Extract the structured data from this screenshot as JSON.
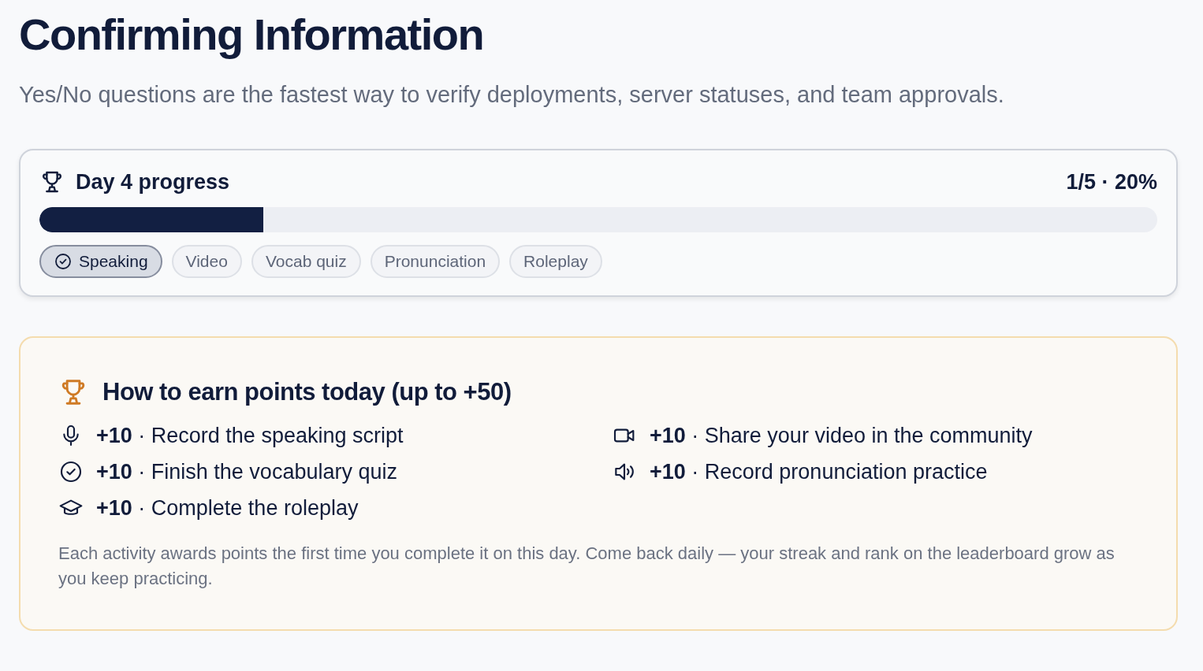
{
  "title": "Confirming Information",
  "subtitle": "Yes/No questions are the fastest way to verify deployments, server statuses, and team approvals.",
  "progress": {
    "title": "Day 4 progress",
    "summary": "1/5 · 20%",
    "level": 0.2,
    "chips": [
      {
        "label": "Speaking",
        "selected": true
      },
      {
        "label": "Video",
        "selected": false
      },
      {
        "label": "Vocab quiz",
        "selected": false
      },
      {
        "label": "Pronunciation",
        "selected": false
      },
      {
        "label": "Roleplay",
        "selected": false
      }
    ]
  },
  "points": {
    "title": "How to earn points today (up to +50)",
    "items": [
      {
        "kind": "mic",
        "text": "**+10** · Record the speaking script"
      },
      {
        "kind": "video",
        "text": "**+10** · Share your video in the community"
      },
      {
        "kind": "check",
        "text": "**+10** · Finish the vocabulary quiz"
      },
      {
        "kind": "speaker",
        "text": "**+10** · Record pronunciation practice"
      },
      {
        "kind": "cap",
        "text": "**+10** · Complete the roleplay"
      }
    ],
    "note": "Each activity awards points the first time you complete it on this day. Come back daily — your streak and rank on the leaderboard grow as you keep practicing."
  }
}
